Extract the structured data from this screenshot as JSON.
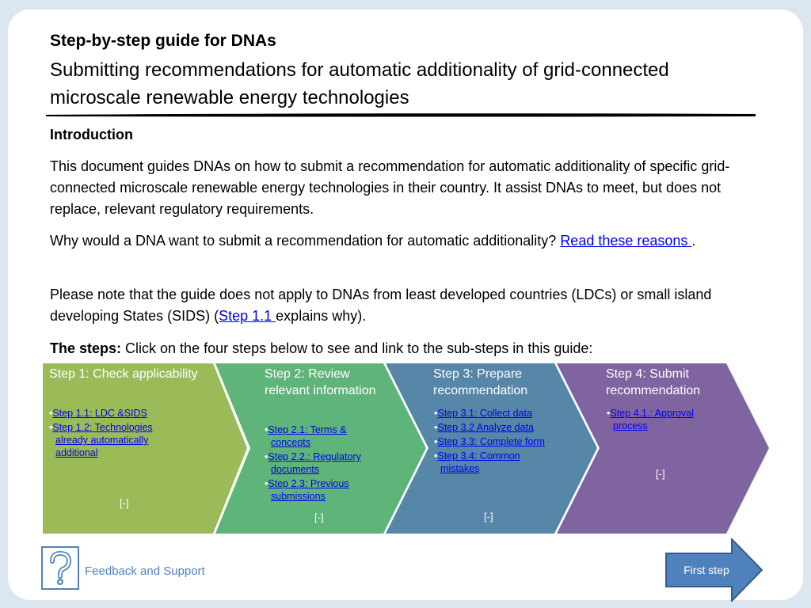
{
  "header": {
    "title": "Step-by-step guide for DNAs",
    "subtitle": "Submitting recommendations for automatic additionality of grid-connected microscale renewable energy technologies"
  },
  "intro": {
    "heading": "Introduction",
    "p1": "This document guides DNAs on how to submit a recommendation for automatic additionality of specific grid-connected microscale renewable energy technologies in their country.  It assist DNAs to meet, but does not replace, relevant regulatory requirements.",
    "p2_text": "Why would a DNA want to submit a recommendation for automatic additionality?  ",
    "p2_link": "Read these reasons ",
    "p2_end": ".",
    "p3_text": "Please note that the guide does not apply to DNAs from least developed countries (LDCs) or small island developing States (SIDS) (",
    "p3_link": "Step 1.1 ",
    "p3_end": "explains why).",
    "steps_label": "The steps:",
    "steps_text": " Click on the four steps below to see and link to the sub-steps  in this guide:"
  },
  "steps": [
    {
      "title": "Step 1: Check applicability",
      "color": "#9bbb59",
      "items": [
        "Step 1.1: LDC &SIDS",
        "Step 1.2: Technologies already automatically additional"
      ],
      "collapse": "[-]"
    },
    {
      "title": "Step 2: Review relevant information",
      "color": "#5fb47a",
      "items": [
        "Step 2.1: Terms & concepts",
        "Step 2.2.: Regulatory documents",
        "Step 2.3: Previous submissions"
      ],
      "collapse": "[-]"
    },
    {
      "title": "Step 3: Prepare recommendation",
      "color": "#5686a8",
      "items": [
        "Step 3.1: Collect data",
        "Step 3.2 Analyze data",
        "Step 3.3: Complete form",
        "Step 3.4:  Common mistakes"
      ],
      "collapse": "[-]"
    },
    {
      "title": "Step 4: Submit recommendation",
      "color": "#8064a2",
      "items": [
        "Step 4.1.: Approval process"
      ],
      "collapse": "[-]"
    }
  ],
  "footer": {
    "help_icon": "question-mark-icon",
    "feedback": "Feedback and Support",
    "first_step": "First step",
    "arrow_color": "#4f81bd"
  }
}
